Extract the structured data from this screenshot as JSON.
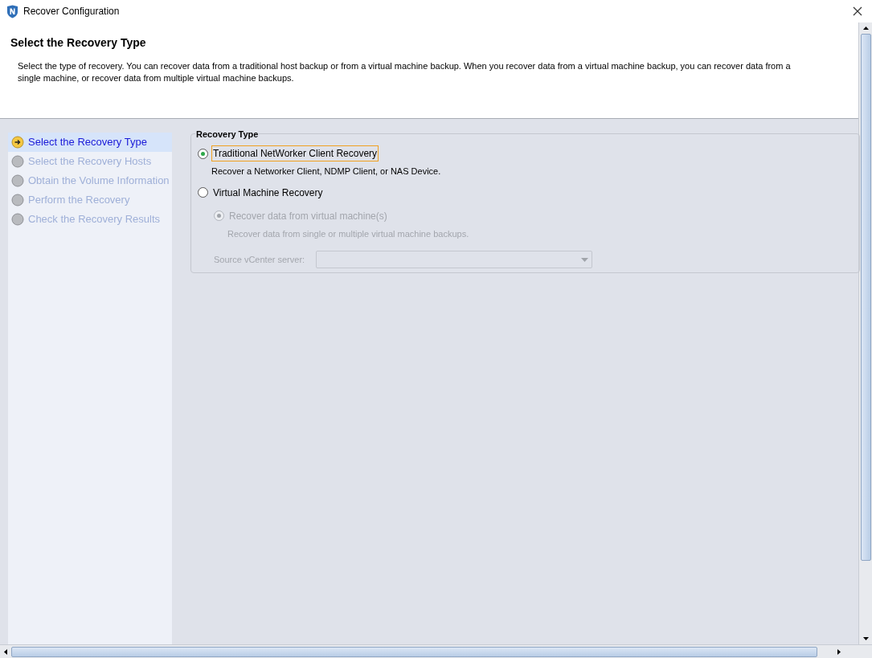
{
  "window": {
    "title": "Recover Configuration"
  },
  "header": {
    "title": "Select the Recovery Type",
    "description": "Select the type of recovery. You can recover data from a traditional host backup or from a virtual machine backup.  When you recover data from a virtual machine backup, you can recover data from a single machine, or recover data from multiple virtual machine backups."
  },
  "steps": [
    {
      "label": "Select the Recovery Type",
      "selected": true
    },
    {
      "label": "Select the Recovery Hosts",
      "selected": false
    },
    {
      "label": "Obtain the Volume Information",
      "selected": false
    },
    {
      "label": "Perform the Recovery",
      "selected": false
    },
    {
      "label": "Check the Recovery Results",
      "selected": false
    }
  ],
  "recovery_type": {
    "legend": "Recovery Type",
    "options": [
      {
        "label": "Traditional NetWorker Client Recovery",
        "description": "Recover a Networker Client, NDMP Client, or NAS Device.",
        "selected": true,
        "focused": true,
        "disabled": false
      },
      {
        "label": "Virtual Machine Recovery",
        "selected": false,
        "focused": false,
        "disabled": false,
        "suboptions": [
          {
            "label": "Recover data from virtual machine(s)",
            "description": "Recover data from single or multiple virtual machine backups.",
            "selected": true,
            "focused": false,
            "disabled": true
          }
        ],
        "source_field": {
          "label": "Source vCenter server:",
          "disabled": true
        }
      }
    ]
  }
}
